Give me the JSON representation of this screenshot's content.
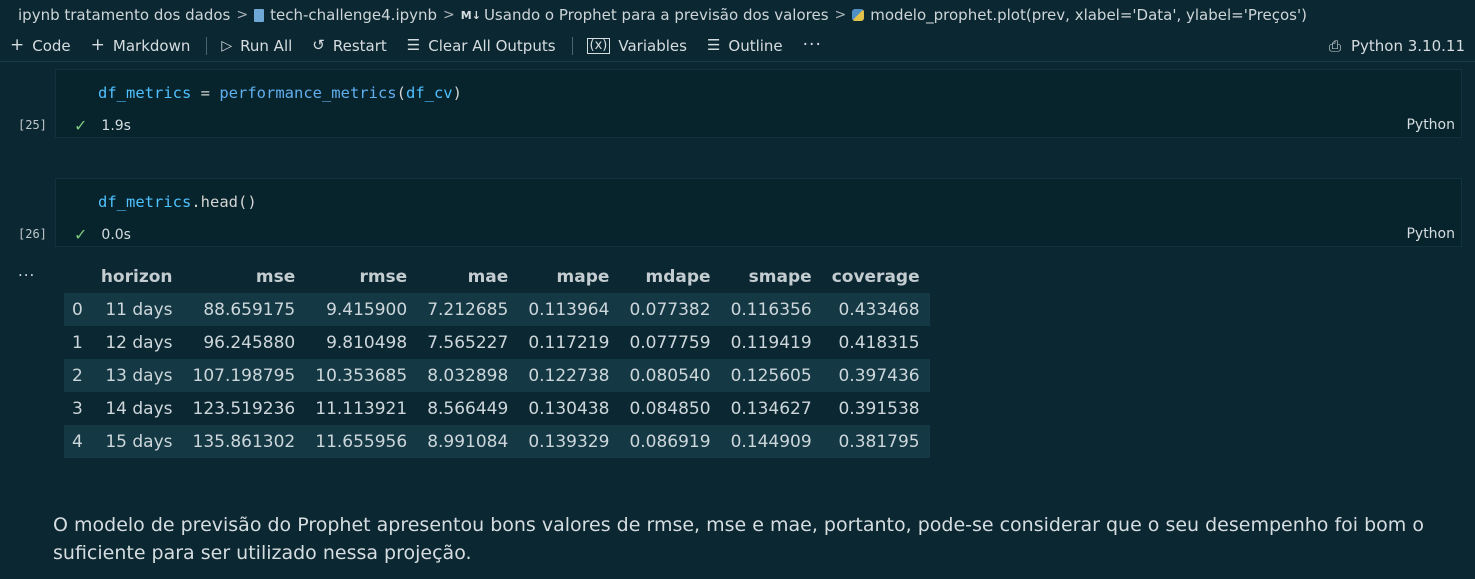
{
  "breadcrumb": {
    "folder": "ipynb tratamento dos dados",
    "file": "tech-challenge4.ipynb",
    "section": "Usando o Prophet para a previsão dos valores",
    "cell": "modelo_prophet.plot(prev, xlabel='Data', ylabel='Preços')"
  },
  "toolbar": {
    "code_label": "Code",
    "markdown_label": "Markdown",
    "run_all_label": "Run All",
    "restart_label": "Restart",
    "clear_label": "Clear All Outputs",
    "variables_label": "Variables",
    "outline_label": "Outline",
    "kernel_label": "Python 3.10.11"
  },
  "cells": [
    {
      "exec_count": "[25]",
      "code": {
        "var": "df_metrics",
        "op": " = ",
        "fn": "performance_metrics",
        "open": "(",
        "arg": "df_cv",
        "close": ")"
      },
      "status": "1.9s",
      "language": "Python"
    },
    {
      "exec_count": "[26]",
      "code": {
        "var": "df_metrics",
        "method": ".head",
        "call": "()"
      },
      "status": "0.0s",
      "language": "Python"
    }
  ],
  "output_dots": "...",
  "table": {
    "columns": [
      "",
      "horizon",
      "mse",
      "rmse",
      "mae",
      "mape",
      "mdape",
      "smape",
      "coverage"
    ],
    "rows": [
      [
        "0",
        "11 days",
        "88.659175",
        "9.415900",
        "7.212685",
        "0.113964",
        "0.077382",
        "0.116356",
        "0.433468"
      ],
      [
        "1",
        "12 days",
        "96.245880",
        "9.810498",
        "7.565227",
        "0.117219",
        "0.077759",
        "0.119419",
        "0.418315"
      ],
      [
        "2",
        "13 days",
        "107.198795",
        "10.353685",
        "8.032898",
        "0.122738",
        "0.080540",
        "0.125605",
        "0.397436"
      ],
      [
        "3",
        "14 days",
        "123.519236",
        "11.113921",
        "8.566449",
        "0.130438",
        "0.084850",
        "0.134627",
        "0.391538"
      ],
      [
        "4",
        "15 days",
        "135.861302",
        "11.655956",
        "8.991084",
        "0.139329",
        "0.086919",
        "0.144909",
        "0.381795"
      ]
    ]
  },
  "markdown_text": "O modelo de previsão do Prophet apresentou bons valores de rmse, mse e mae, portanto, pode-se considerar que o seu desempenho foi bom o suficiente para ser utilizado nessa projeção."
}
